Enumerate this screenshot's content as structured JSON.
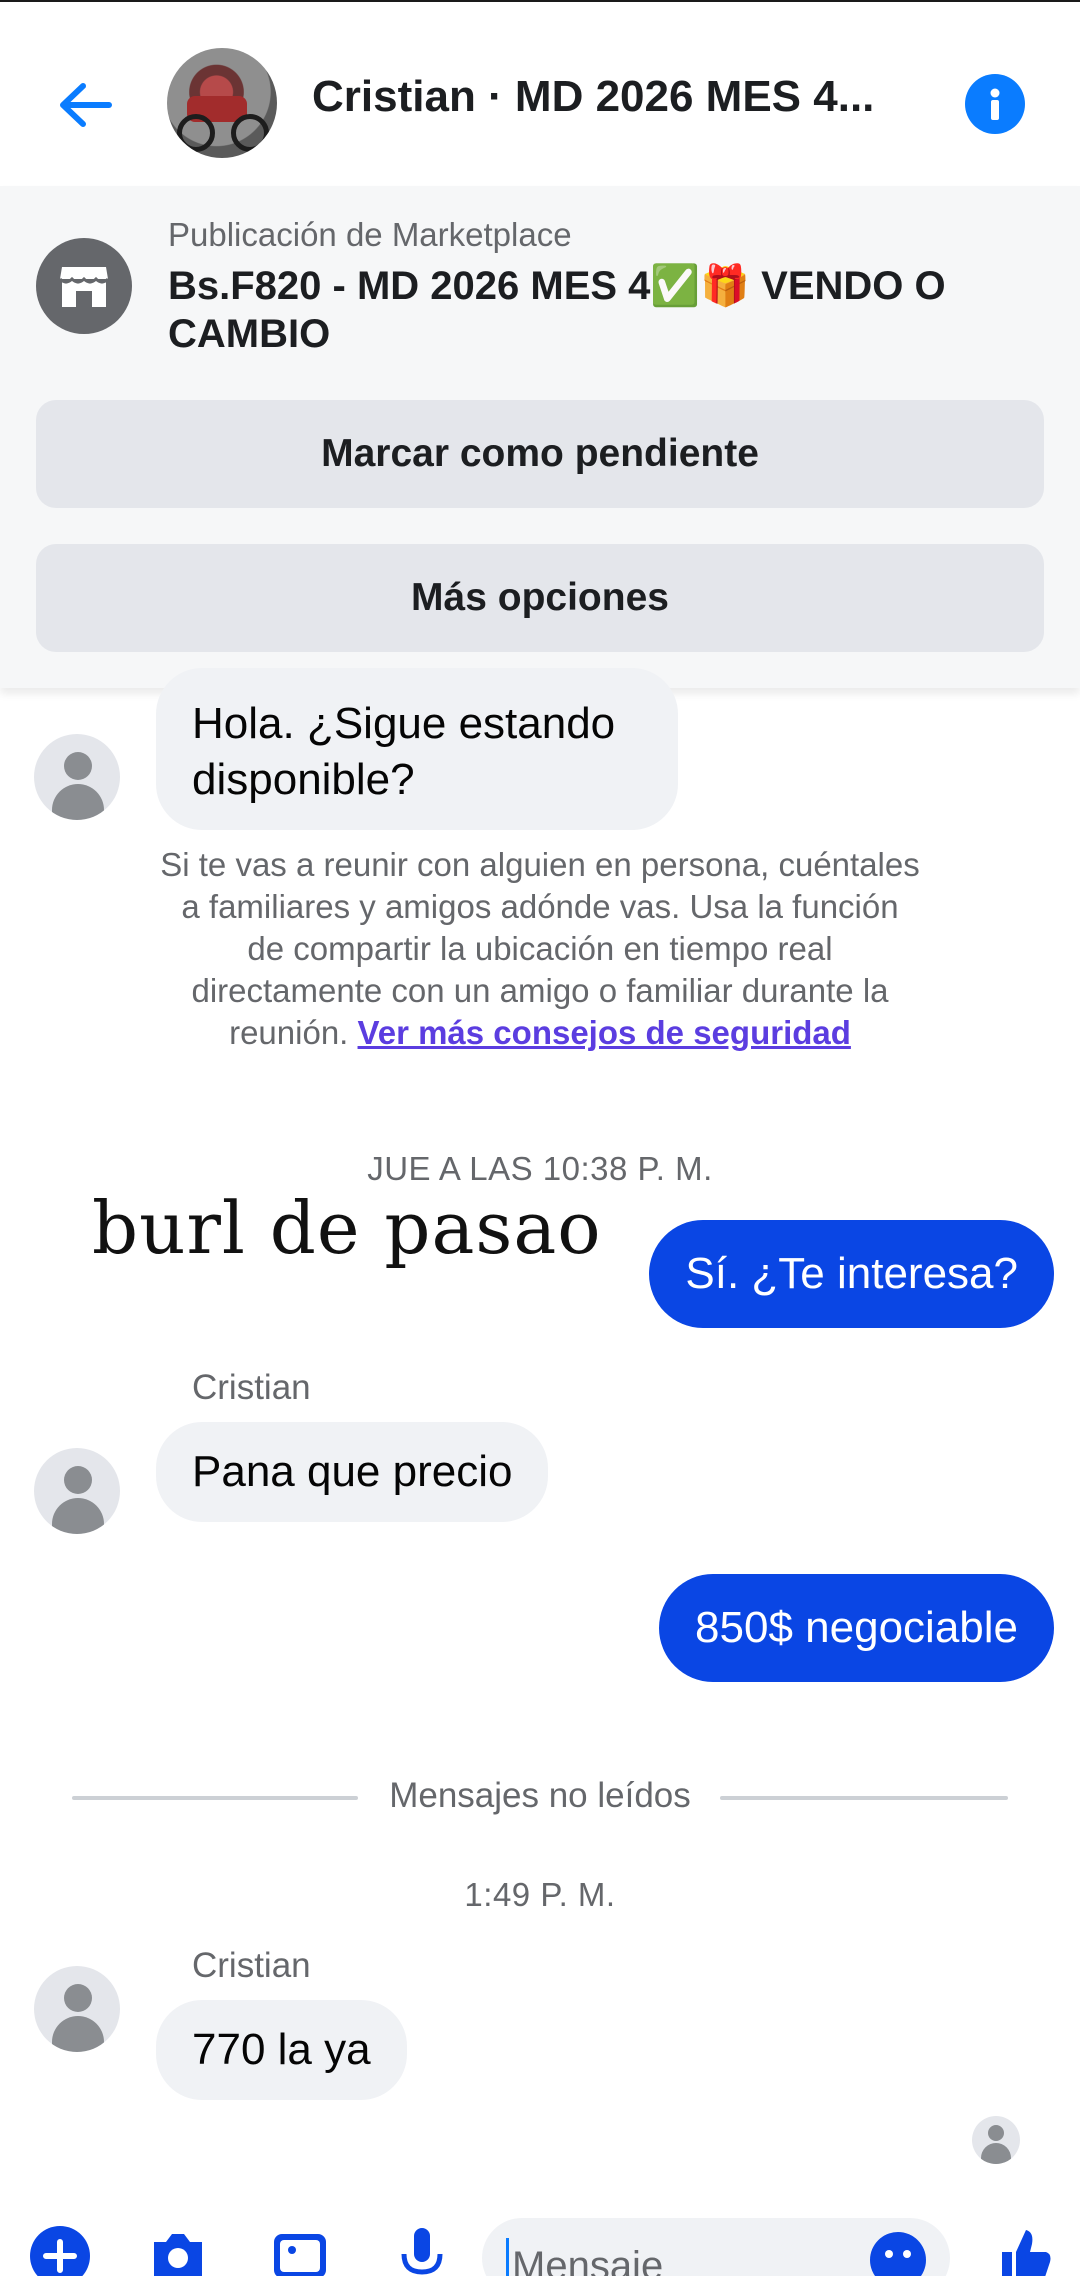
{
  "header": {
    "title": "Cristian · MD 2026 MES 4...",
    "icons": [
      "back-arrow-icon",
      "info-icon"
    ]
  },
  "marketplace": {
    "label": "Publicación de Marketplace",
    "title": "Bs.F820 - MD 2026 MES 4✅🎁 VENDO O CAMBIO",
    "buttons": {
      "pending": "Marcar como pendiente",
      "more": "Más opciones"
    }
  },
  "chat": {
    "messages": [
      {
        "from": "them",
        "text": "Hola. ¿Sigue estando disponible?"
      },
      {
        "from": "me",
        "text": "Sí. ¿Te interesa?"
      },
      {
        "from": "them",
        "sender": "Cristian",
        "text": "Pana que precio"
      },
      {
        "from": "me",
        "text": "850$ negociable"
      },
      {
        "from": "them",
        "sender": "Cristian",
        "text": "770 la ya"
      }
    ],
    "safety_text": "Si te vas a reunir con alguien en persona, cuéntales a familiares y amigos adónde vas. Usa la función de compartir la ubicación en tiempo real directamente con un amigo o familiar durante la reunión.",
    "safety_link": "Ver más consejos de seguridad",
    "time1": "JUE A LAS 10:38 P. M.",
    "unread_label": "Mensajes no leídos",
    "time2": "1:49 P. M.",
    "handwritten_overlay": "burl de pasao"
  },
  "composer": {
    "placeholder": "Mensaje"
  },
  "colors": {
    "accent": "#0a7cff",
    "outgoing_bubble": "#0a46e4",
    "incoming_bubble": "#f0f2f5",
    "link": "#5b3de0"
  }
}
